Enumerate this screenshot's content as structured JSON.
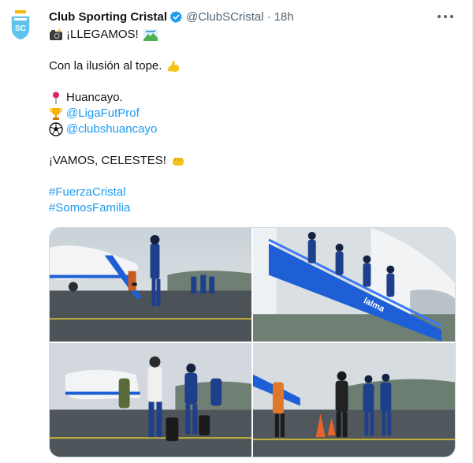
{
  "tweet": {
    "display_name": "Club Sporting Cristal",
    "handle": "@ClubSCristal",
    "separator": "·",
    "time": "18h",
    "line1": "¡LLEGAMOS!",
    "line2": "Con la ilusión al tope.",
    "location": "Huancayo.",
    "mention1": "@LigaFutProf",
    "mention2": "@clubshuancayo",
    "cheer": "¡VAMOS, CELESTES!",
    "hashtag1": "#FuerzaCristal",
    "hashtag2": "#SomosFamilia"
  },
  "icons": {
    "avatar": "club-crest-icon",
    "verified": "verified-badge-icon",
    "camera": "camera-flash-emoji",
    "arrival": "mountain-plane-emoji",
    "muscle": "flexed-biceps-emoji",
    "pin": "round-pushpin-emoji",
    "trophy": "trophy-emoji",
    "ball": "soccer-ball-emoji",
    "fist": "oncoming-fist-emoji",
    "more": "more-options-icon"
  },
  "colors": {
    "link": "#1d9bf0",
    "verified": "#1d9bf0",
    "crest_sky": "#5ec4ee",
    "stairs_blue": "#1f5fd6"
  }
}
